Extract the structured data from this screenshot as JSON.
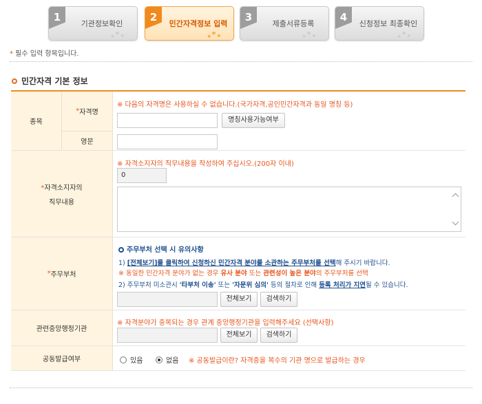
{
  "steps": [
    {
      "num": "1",
      "label": "기관정보확인"
    },
    {
      "num": "2",
      "label": "민간자격정보 입력"
    },
    {
      "num": "3",
      "label": "제출서류등록"
    },
    {
      "num": "4",
      "label": "신청정보 최종확인"
    }
  ],
  "active_step": 2,
  "required_note": {
    "star": "*",
    "text": " 필수 입력 항목입니다."
  },
  "section_title": "민간자격 기본 정보",
  "colors": {
    "accent": "#f08a1c",
    "note": "#e8541c",
    "link": "#1e4f8f",
    "header_bg": "#fff4df"
  },
  "form": {
    "jongmok": {
      "label": "종목",
      "name_label_star": "*",
      "name_label": "자격명",
      "name_note": "※ 다음의 자격명은 사용하실 수 없습니다.(국가자격,공인민간자격과 동일 명칭 등)",
      "name_value": "",
      "check_button": "명칭사용가능여부",
      "eng_label": "영문",
      "eng_value": ""
    },
    "duty": {
      "label_star": "*",
      "label_line1": "자격소지자의",
      "label_line2": "직무내용",
      "note": "※ 자격소지자의 직무내용을 작성하여 주십시오.(200자 이내)",
      "char_count": "0",
      "text_value": ""
    },
    "ministry": {
      "label_star": "*",
      "label": "주무부처",
      "caution_title": "주무부처 선택 시 유의사항",
      "line1": {
        "pre": "1) ",
        "link": "[전체보기]를 클릭하여 신청하신 민간자격 분야를 소관하는 주무부처를 선택",
        "post": "해 주시기 바랍니다."
      },
      "line2": {
        "pre": "※ 동일한 민간자격 분야가 없는 경우 ",
        "b1": "유사 분야",
        "mid": " 또는 ",
        "b2": "관련성이 높은 분야",
        "post": "의 주무부처를 선택"
      },
      "line3": {
        "pre": "2) 주무부처 미소관시 ",
        "b1": "'타부처 이송'",
        "mid1": " 또는 ",
        "b2": "'자문위 심의'",
        "mid2": " 등의 절차로 인해 ",
        "link": "등록 처리가 지연",
        "post": "될 수 있습니다."
      },
      "value": "",
      "view_all_button": "전체보기",
      "search_button": "검색하기"
    },
    "related_agency": {
      "label": "관련중앙행정기관",
      "note": "※ 자격분야가 중복되는 경우 관계 중앙행정기관을 입력해주세요 (선택사항)",
      "value": "",
      "view_all_button": "전체보기",
      "search_button": "검색하기"
    },
    "joint": {
      "label": "공동발급여부",
      "options": [
        "있음",
        "없음"
      ],
      "selected": "없음",
      "note": "※ 공동발급이란? 자격증을 복수의 기관 명으로 발급하는 경우"
    }
  }
}
